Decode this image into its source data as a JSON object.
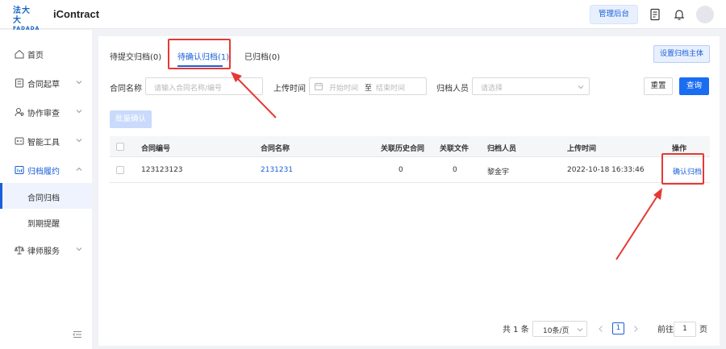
{
  "header": {
    "logo_line1": "法大大",
    "logo_line2": "FADADA",
    "app_title": "iContract",
    "admin_button": "管理后台",
    "icons": [
      "document-icon",
      "bell-icon",
      "avatar"
    ]
  },
  "sidebar": {
    "items": [
      {
        "label": "首页",
        "icon": "home-icon"
      },
      {
        "label": "合同起草",
        "icon": "draft-icon"
      },
      {
        "label": "协作审查",
        "icon": "review-icon"
      },
      {
        "label": "智能工具",
        "icon": "tools-icon"
      },
      {
        "label": "归档履约",
        "icon": "archive-icon"
      },
      {
        "label": "律师服务",
        "icon": "scale-icon"
      }
    ],
    "sub_items": [
      {
        "label": "合同归档"
      },
      {
        "label": "到期提醒"
      }
    ]
  },
  "tabs": [
    {
      "label": "待提交归档(0)"
    },
    {
      "label": "待确认归档(1)"
    },
    {
      "label": "已归档(0)"
    }
  ],
  "set_archive_subject_button": "设置归档主体",
  "filters": {
    "contract_name_label": "合同名称",
    "contract_name_placeholder": "请输入合同名称/编号",
    "upload_time_label": "上传时间",
    "start_placeholder": "开始时间",
    "range_separator": "至",
    "end_placeholder": "结束时间",
    "archiver_label": "归档人员",
    "archiver_placeholder": "请选择",
    "reset_button": "重置",
    "query_button": "查询"
  },
  "batch_confirm_button": "批量确认",
  "table": {
    "columns": [
      "合同编号",
      "合同名称",
      "关联历史合同",
      "关联文件",
      "归档人员",
      "上传时间",
      "操作"
    ],
    "rows": [
      {
        "contract_no": "123123123",
        "contract_name": "2131231",
        "related_history": "0",
        "related_files": "0",
        "archiver": "黎金宇",
        "upload_time": "2022-10-18 16:33:46",
        "action": "确认归档"
      }
    ]
  },
  "pagination": {
    "total": "共 1 条",
    "page_size": "10条/页",
    "current_page": "1",
    "goto_label": "前往",
    "goto_value": "1",
    "page_unit": "页"
  },
  "colors": {
    "accent": "#1a5fd8",
    "highlight": "#e53935"
  }
}
